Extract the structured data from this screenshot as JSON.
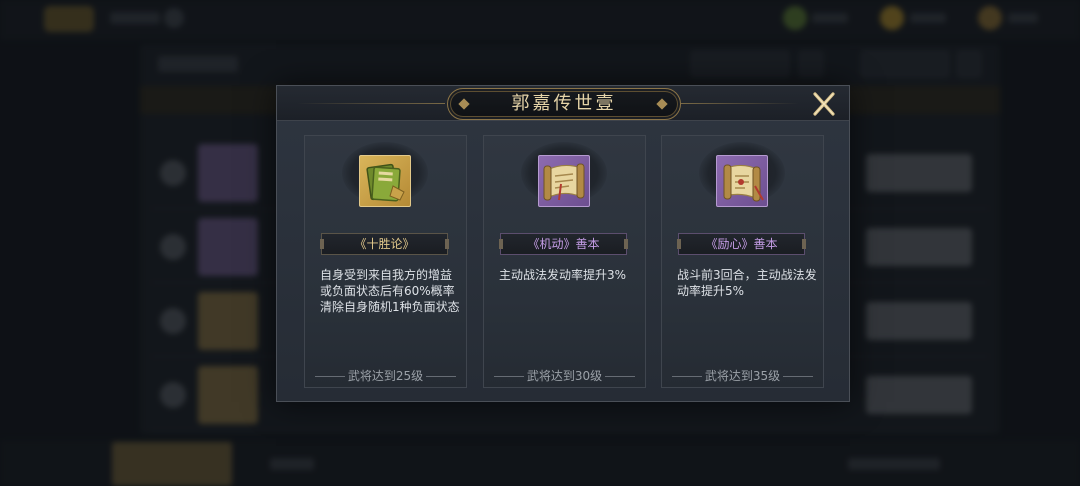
{
  "dialog": {
    "title": "郭嘉传世壹",
    "close_icon": "close-x-icon",
    "accent_color": "#e6d4a8"
  },
  "cards": [
    {
      "icon": "gold-book-icon",
      "rarity_color": "#e1c88b",
      "name": "《十胜论》",
      "description": "自身受到来自我方的增益或负面状态后有60%概率清除自身随机1种负面状态",
      "requirement": "武将达到25级"
    },
    {
      "icon": "purple-scroll-icon",
      "rarity_color": "#c59de6",
      "name": "《机动》善本",
      "description": "主动战法发动率提升3%",
      "requirement": "武将达到30级"
    },
    {
      "icon": "purple-scroll-icon",
      "rarity_color": "#c59de6",
      "name": "《励心》善本",
      "description": "战斗前3回合，主动战法发动率提升5%",
      "requirement": "武将达到35级"
    }
  ]
}
